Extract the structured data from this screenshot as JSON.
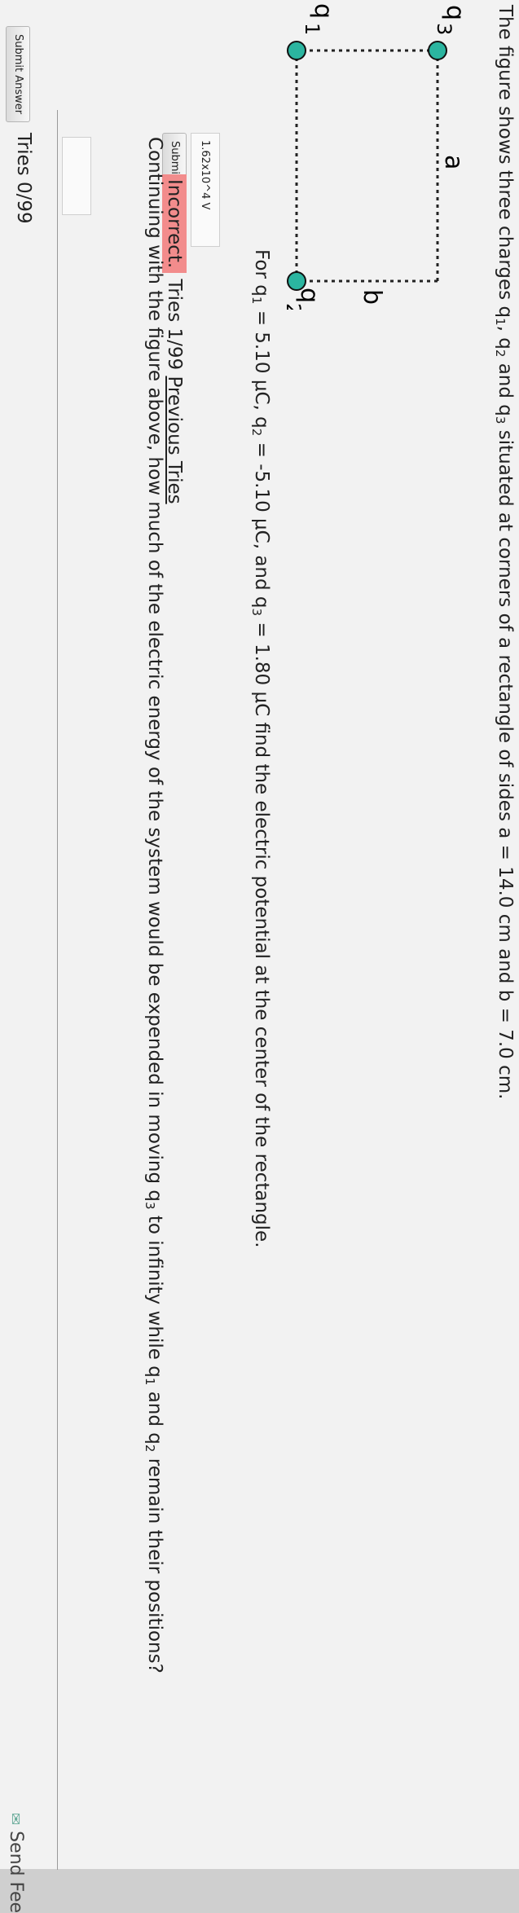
{
  "question1": {
    "intro": "The figure shows three charges q",
    "intro2": ", q",
    "intro3": " and q",
    "intro4": " situated at corners of a rectangle of sides a = 14.0 cm and b = 7.0 cm.",
    "sub1": "1",
    "sub2": "2",
    "sub3": "3",
    "given_a": "For q",
    "given_b": " = 5.10 μC, q",
    "given_c": " = -5.10 μC, and q",
    "given_d": " = 1.80 μC find the electric potential at the center of the rectangle.",
    "answer_value": "1.62x10^4 V",
    "submit_label": "Submit Answer",
    "status_badge": "Incorrect.",
    "tries_text": "Tries 1/99",
    "previous_tries": "Previous Tries"
  },
  "figure": {
    "label_q3": "q",
    "label_q3_num": "3",
    "label_q1": "q",
    "label_q1_num": "1",
    "label_q2": "q",
    "label_q2_num": "2",
    "label_a": "a",
    "label_b": "b",
    "charge_color": "#2bb5a0"
  },
  "question2": {
    "text_a": "Continuing with the figure above, how much of the electric energy of the system would be expended in moving q",
    "text_b": " to infinity while q",
    "text_c": " and q",
    "text_d": " remain their positions?",
    "sub3": "3",
    "sub1": "1",
    "sub2": "2",
    "answer_value": "",
    "submit_label": "Submit Answer",
    "tries_text": "Tries 0/99"
  },
  "footer": {
    "send_feedback": "Send Fee"
  }
}
